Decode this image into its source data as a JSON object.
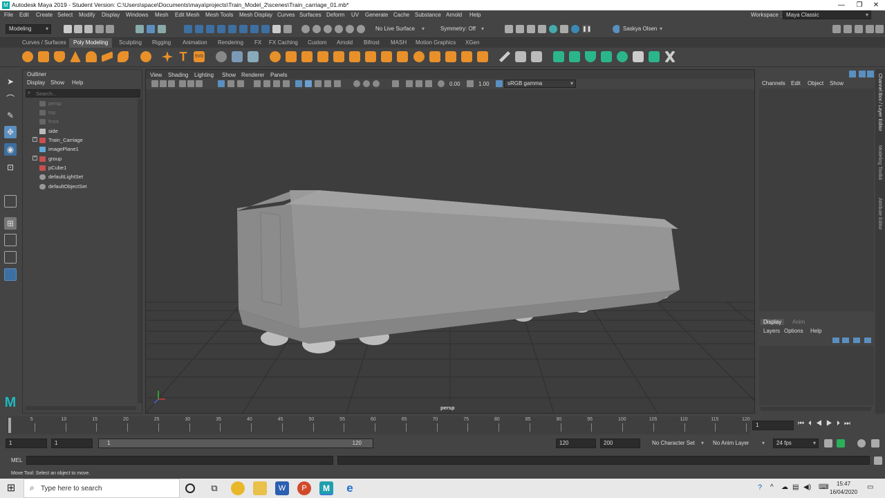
{
  "window": {
    "title": "Autodesk Maya 2019 - Student Version: C:\\Users\\space\\Documents\\maya\\projects\\Train_Model_2\\scenes\\Train_carriage_01.mb*",
    "minimize": "—",
    "maximize": "❐",
    "close": "✕"
  },
  "menu": [
    "File",
    "Edit",
    "Create",
    "Select",
    "Modify",
    "Display",
    "Windows",
    "Mesh",
    "Edit Mesh",
    "Mesh Tools",
    "Mesh Display",
    "Curves",
    "Surfaces",
    "Deform",
    "UV",
    "Generate",
    "Cache",
    "Substance",
    "Arnold",
    "Help"
  ],
  "workspace": {
    "label": "Workspace :",
    "value": "Maya Classic"
  },
  "status": {
    "mode": "Modeling",
    "live_surface": "No Live Surface",
    "symmetry": "Symmetry: Off",
    "user": "Saskya Olsen"
  },
  "shelf_tabs": [
    "Curves / Surfaces",
    "Poly Modeling",
    "Sculpting",
    "Rigging",
    "Animation",
    "Rendering",
    "FX",
    "FX Caching",
    "Custom",
    "Arnold",
    "Bifrost",
    "MASH",
    "Motion Graphics",
    "XGen"
  ],
  "shelf_active": "Poly Modeling",
  "outliner": {
    "title": "Outliner",
    "menu": [
      "Display",
      "Show",
      "Help"
    ],
    "search_placeholder": "Search...",
    "items": [
      {
        "label": "persp",
        "dim": true
      },
      {
        "label": "top",
        "dim": true
      },
      {
        "label": "front",
        "dim": true
      },
      {
        "label": "side",
        "dim": false
      },
      {
        "label": "Train_Carriage",
        "dim": false
      },
      {
        "label": "imagePlane1",
        "dim": false
      },
      {
        "label": "group",
        "dim": false
      },
      {
        "label": "pCube1",
        "dim": false
      },
      {
        "label": "defaultLightSet",
        "dim": false
      },
      {
        "label": "defaultObjectSet",
        "dim": false
      }
    ]
  },
  "viewport": {
    "menu": [
      "View",
      "Shading",
      "Lighting",
      "Show",
      "Renderer",
      "Panels"
    ],
    "field_a": "0.00",
    "field_b": "1.00",
    "color_space": "sRGB gamma",
    "camera_label": "persp"
  },
  "channel_box": {
    "menu": [
      "Channels",
      "Edit",
      "Object",
      "Show"
    ],
    "layer_tabs": [
      "Display",
      "Anim"
    ],
    "layer_menu": [
      "Layers",
      "Options",
      "Help"
    ]
  },
  "side_tabs": [
    "Channel Box / Layer Editor",
    "Modeling Toolkit",
    "Attribute Editor"
  ],
  "timeline": {
    "ticks": [
      "5",
      "10",
      "15",
      "20",
      "25",
      "30",
      "35",
      "40",
      "45",
      "50",
      "55",
      "60",
      "65",
      "70",
      "75",
      "80",
      "85",
      "90",
      "95",
      "100",
      "105",
      "110",
      "115",
      "120"
    ],
    "current_frame": "1"
  },
  "range": {
    "start": "1",
    "anim_start": "1",
    "slider_start": "1",
    "slider_end": "120",
    "end": "120",
    "anim_end": "200",
    "character_set": "No Character Set",
    "anim_layer": "No Anim Layer",
    "fps": "24 fps"
  },
  "mel_label": "MEL",
  "help_line": "Move Tool: Select an object to move.",
  "taskbar": {
    "search_placeholder": "Type here to search",
    "time": "15:47",
    "date": "16/04/2020"
  }
}
